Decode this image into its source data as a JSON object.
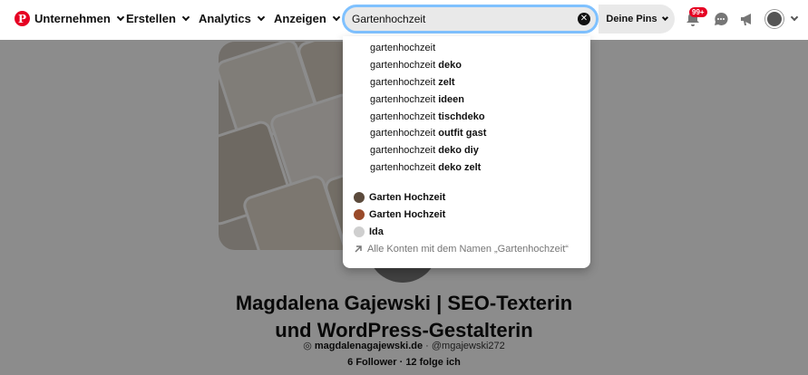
{
  "nav": {
    "items": [
      "Unternehmen",
      "Erstellen",
      "Analytics",
      "Anzeigen"
    ]
  },
  "search": {
    "value": "Gartenhochzeit",
    "scope": "Deine Pins"
  },
  "notifications": {
    "badge": "99+"
  },
  "dropdown": {
    "query": "gartenhochzeit",
    "suggestions": [
      {
        "prefix": "gartenhochzeit",
        "suffix": ""
      },
      {
        "prefix": "gartenhochzeit",
        "suffix": "deko"
      },
      {
        "prefix": "gartenhochzeit",
        "suffix": "zelt"
      },
      {
        "prefix": "gartenhochzeit",
        "suffix": "ideen"
      },
      {
        "prefix": "gartenhochzeit",
        "suffix": "tischdeko"
      },
      {
        "prefix": "gartenhochzeit",
        "suffix": "outfit gast"
      },
      {
        "prefix": "gartenhochzeit",
        "suffix": "deko diy"
      },
      {
        "prefix": "gartenhochzeit",
        "suffix": "deko zelt"
      }
    ],
    "accounts": [
      {
        "name": "Garten Hochzeit",
        "color": "#5b4a3c"
      },
      {
        "name": "Garten Hochzeit",
        "color": "#9a4b2a"
      },
      {
        "name": "Ida",
        "color": "#cfcfcf"
      }
    ],
    "all_accounts_label": "Alle Konten mit dem Namen „Gartenhochzeit“"
  },
  "profile": {
    "name_line1": "Magdalena Gajewski | SEO-Texterin",
    "name_line2": "und WordPress-Gestalterin",
    "website": "magdalenagajewski.de",
    "handle": "· @mgajewski272",
    "counts": "6 Follower · 12 folge ich"
  },
  "colors": {
    "brand": "#e60023",
    "focus": "#7fc1ff"
  }
}
